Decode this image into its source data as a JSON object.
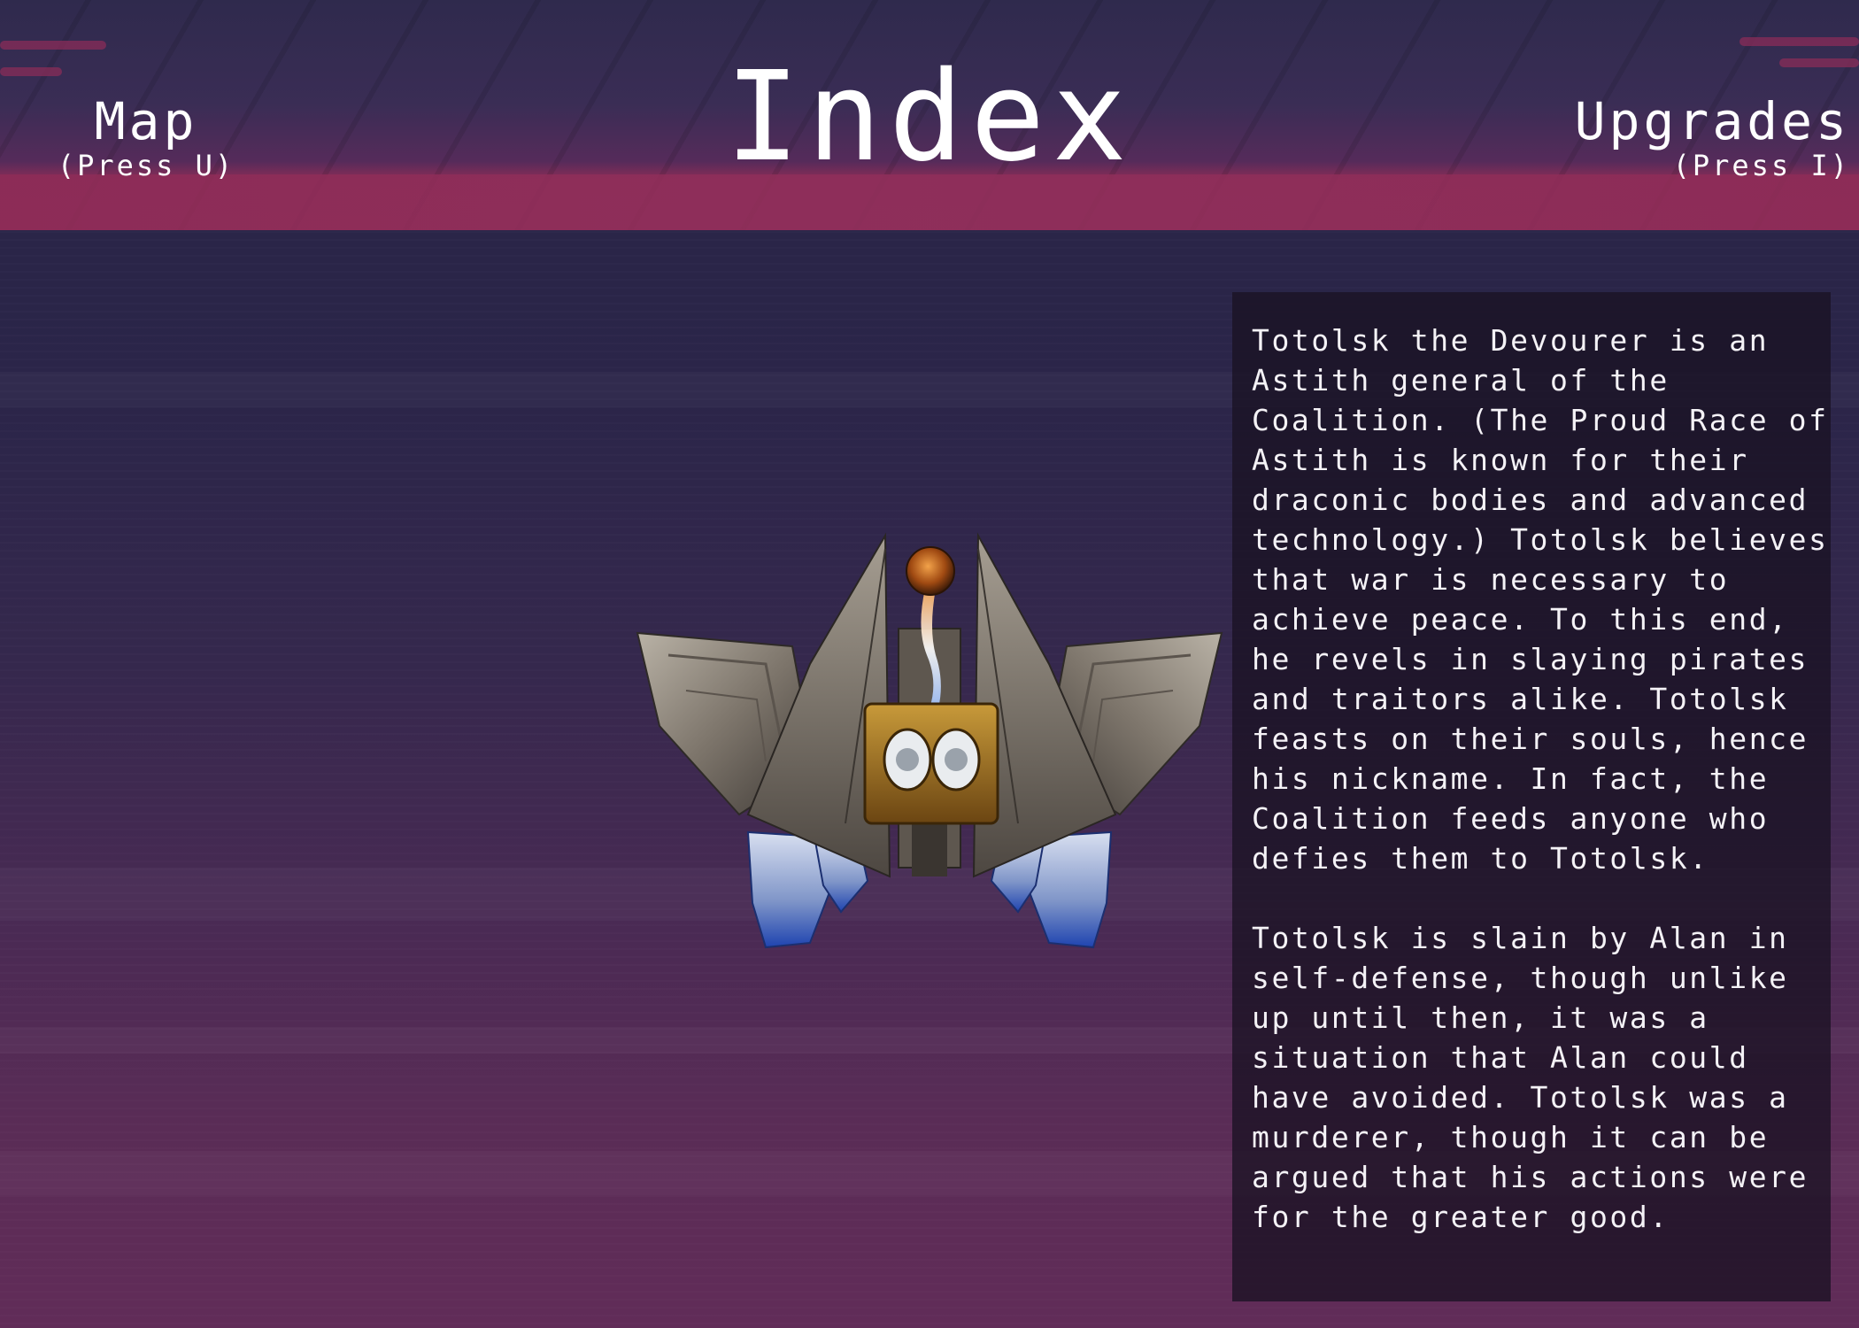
{
  "header": {
    "title": "Index",
    "left_nav": {
      "label": "Map",
      "hint": "(Press U)"
    },
    "right_nav": {
      "label": "Upgrades",
      "hint": "(Press I)"
    }
  },
  "entry": {
    "description": "Totolsk the Devourer is an\nAstith general of the\nCoalition. (The Proud Race of\nAstith is known for their\ndraconic bodies and advanced\ntechnology.) Totolsk believes\nthat war is necessary to\nachieve peace. To this end,\nhe revels in slaying pirates\nand traitors alike. Totolsk\nfeasts on their souls, hence\nhis nickname. In fact, the\nCoalition feeds anyone who\ndefies them to Totolsk.\n\nTotolsk is slain by Alan in\nself-defense, though unlike\nup until then, it was a\nsituation that Alan could\nhave avoided. Totolsk was a\nmurderer, though it can be\nargued that his actions were\nfor the greater good.",
    "sprite_icon": "warship-sprite"
  },
  "colors": {
    "header_band": "#8c2d58",
    "background_top": "#282547",
    "background_bottom": "#612c58",
    "panel": "#1a1222",
    "text": "#ffffff"
  }
}
